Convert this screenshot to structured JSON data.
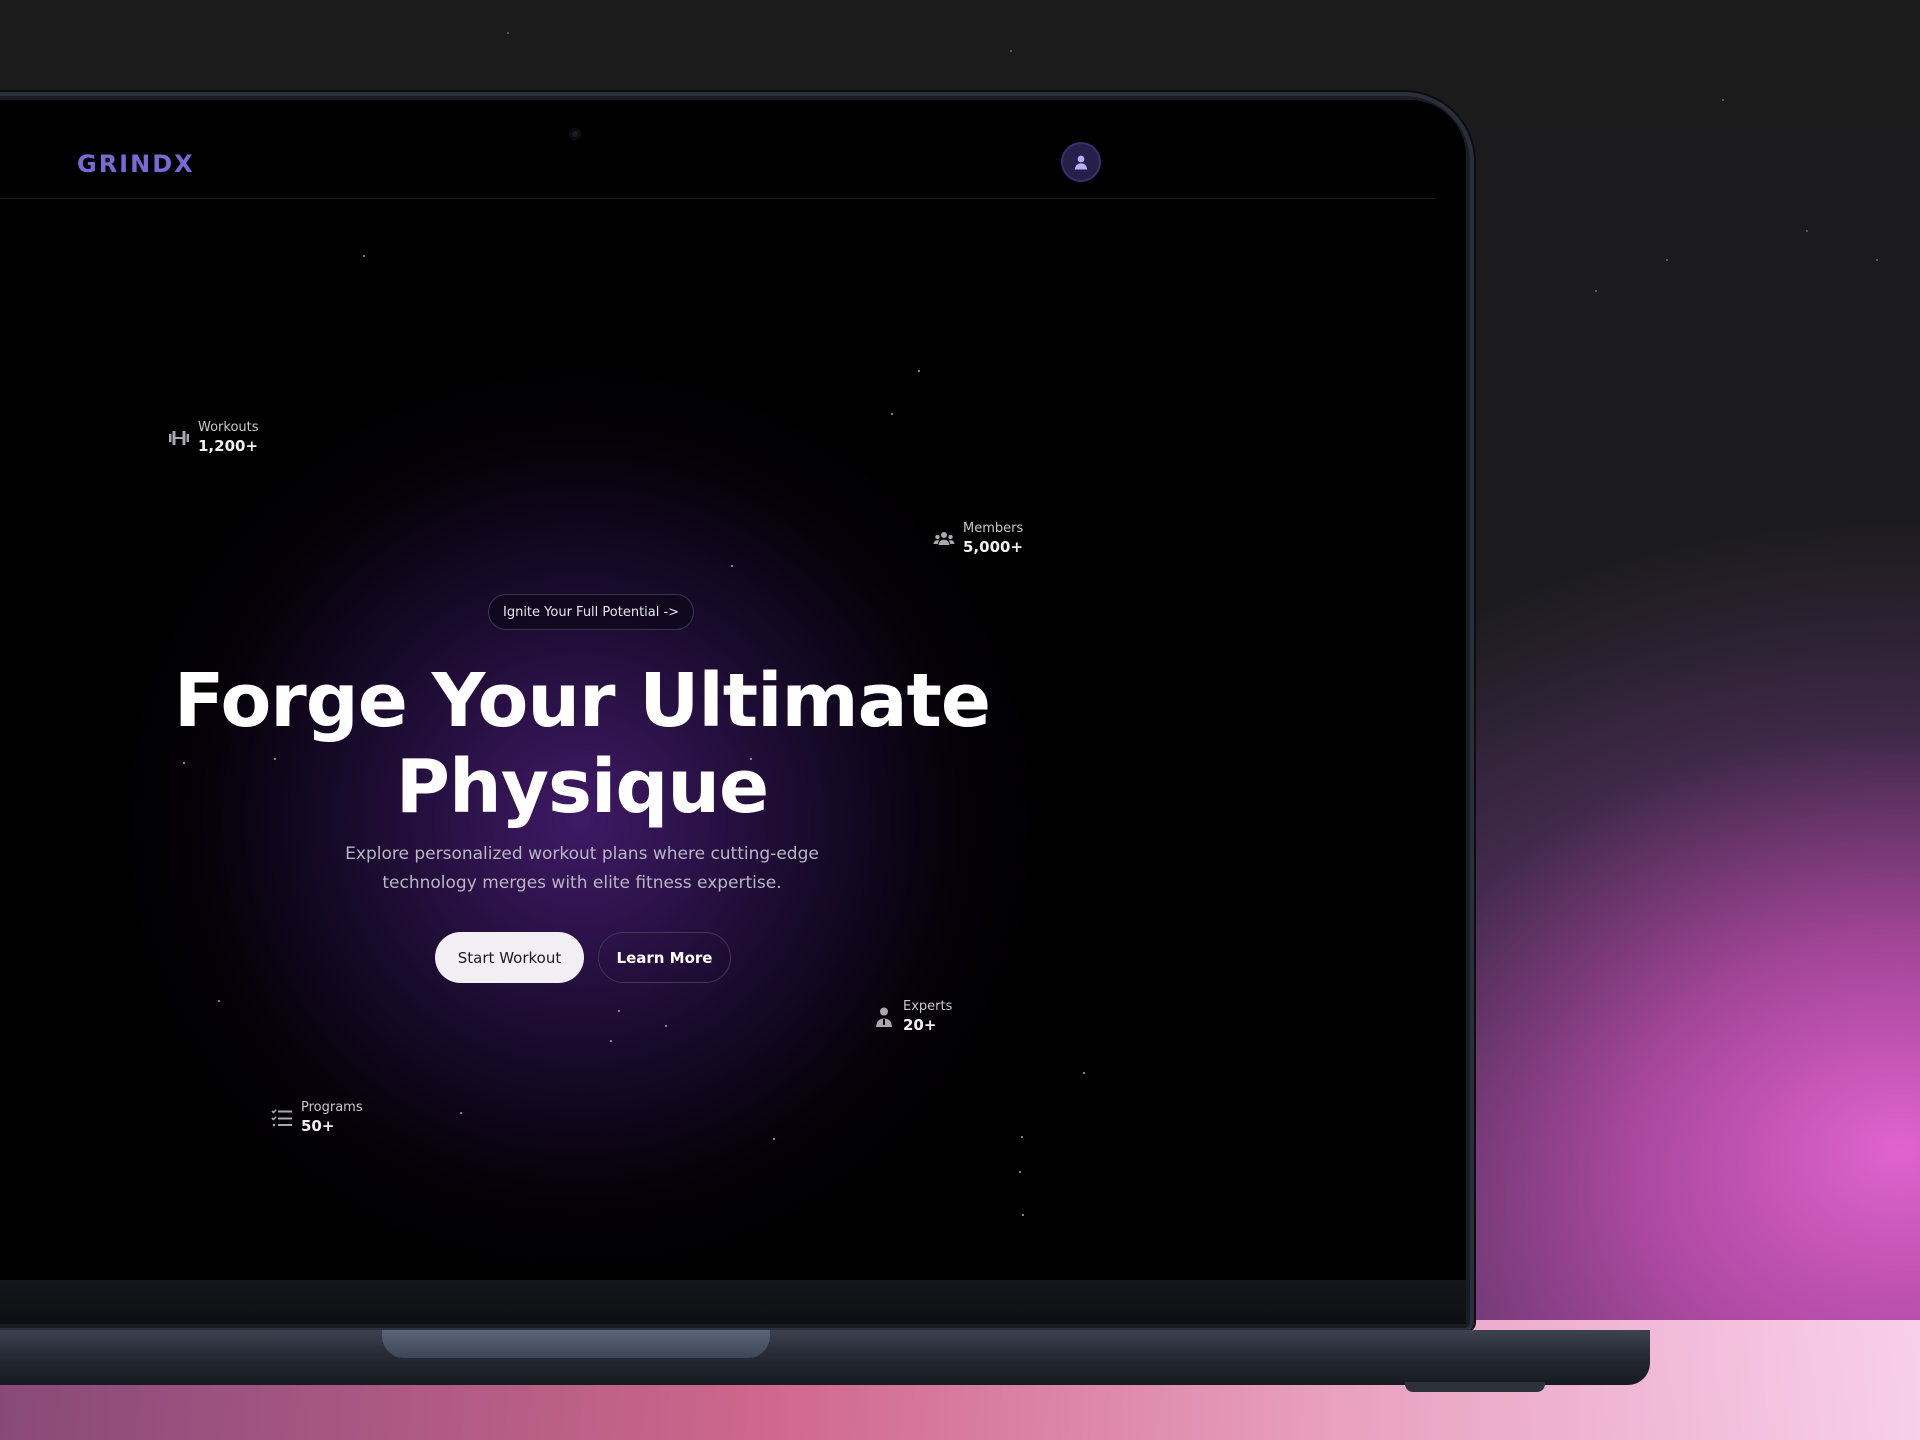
{
  "navbar": {
    "logo": "GRINDX",
    "avatar_icon": "user-icon"
  },
  "hero": {
    "tagline": "Ignite Your Full Potential ->",
    "headline_line1": "Forge Your Ultimate",
    "headline_line2": "Physique",
    "subtext_line1": "Explore personalized workout plans where cutting-edge",
    "subtext_line2": "technology merges with elite fitness expertise.",
    "primary_button": "Start Workout",
    "secondary_button": "Learn More"
  },
  "stats": [
    {
      "label": "Workouts",
      "value": "1,200+",
      "icon": "dumbbell-icon"
    },
    {
      "label": "Members",
      "value": "5,000+",
      "icon": "users-icon"
    },
    {
      "label": "Experts",
      "value": "20+",
      "icon": "expert-icon"
    },
    {
      "label": "Programs",
      "value": "50+",
      "icon": "list-icon"
    }
  ],
  "colors": {
    "brand": "#7a68d4",
    "background": "#000000",
    "glow": "#4a1e78",
    "primary_button_bg": "#f1eff3"
  }
}
